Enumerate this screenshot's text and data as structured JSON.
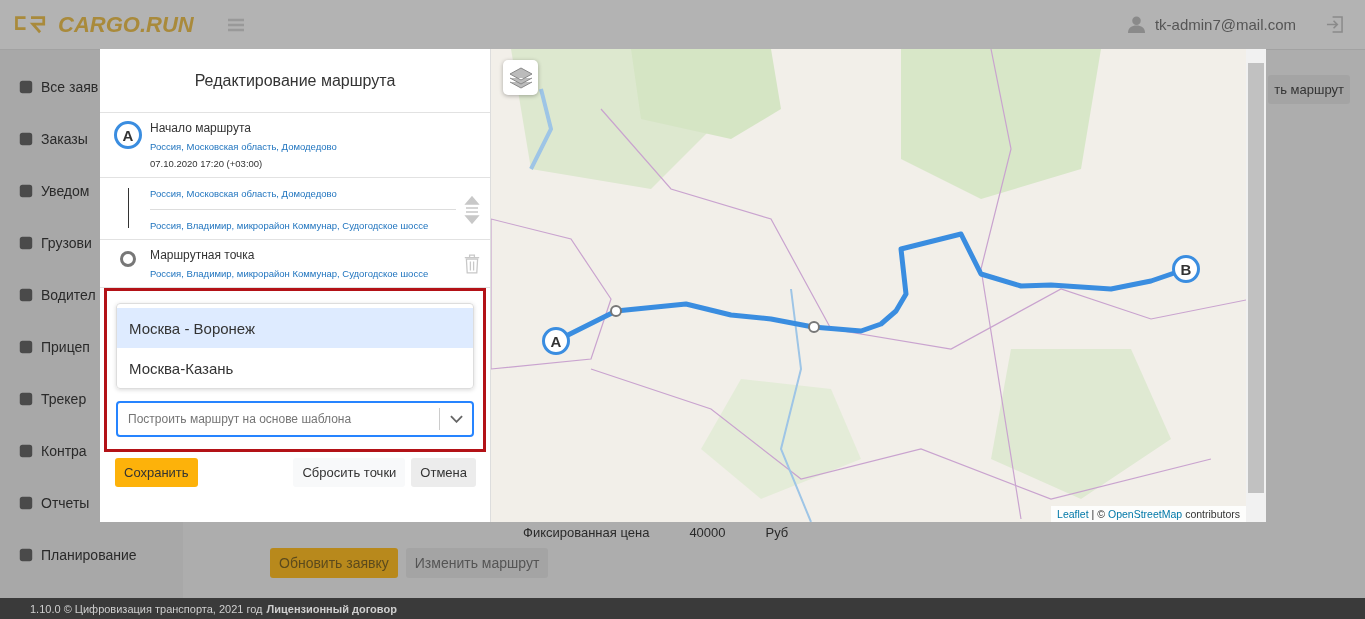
{
  "header": {
    "logo": "CARGO.RUN",
    "user": "tk-admin7@mail.com"
  },
  "sidebar": {
    "items": [
      {
        "label": "Все заяв"
      },
      {
        "label": "Заказы"
      },
      {
        "label": "Уведом"
      },
      {
        "label": "Грузови"
      },
      {
        "label": "Водител"
      },
      {
        "label": "Прицеп"
      },
      {
        "label": "Трекер"
      },
      {
        "label": "Контра"
      },
      {
        "label": "Отчеты"
      },
      {
        "label": "Планирование"
      }
    ]
  },
  "background": {
    "top_button": "ть маршрут",
    "field_label": "Фиксированная цена",
    "field_value": "40000",
    "unit": "Руб",
    "buttons": [
      {
        "label": "Обновить заявку",
        "kind": "primary"
      },
      {
        "label": "Изменить маршрут",
        "kind": "secondary"
      }
    ]
  },
  "modal": {
    "title": "Редактирование маршрута",
    "start": {
      "marker": "A",
      "label": "Начало маршрута",
      "address": "Россия, Московская область, Домодедово",
      "datetime": "07.10.2020 17:20 (+03:00)"
    },
    "segment": {
      "from": "Россия, Московская область, Домодедово",
      "to": "Россия, Владимир, микрорайон Коммунар, Судогодское шоссе"
    },
    "waypoint": {
      "label": "Маршрутная точка",
      "address": "Россия, Владимир, микрорайон Коммунар, Судогодское шоссе"
    },
    "template_select": {
      "placeholder": "Построить маршрут на основе шаблона",
      "options": [
        {
          "label": "Москва - Воронеж",
          "selected": true
        },
        {
          "label": "Москва-Казань",
          "selected": false
        }
      ]
    },
    "buttons": [
      {
        "label": "Сохранить",
        "kind": "primary"
      },
      {
        "label": "Сбросить точки",
        "kind": "link"
      },
      {
        "label": "Отмена",
        "kind": "secondary"
      }
    ]
  },
  "map": {
    "kind": "picture",
    "markers": [
      {
        "label": "A"
      },
      {
        "label": "B"
      }
    ],
    "attribution": {
      "link_1": "Leaflet",
      "separator": "| ©",
      "link_2": "OpenStreetMap",
      "text": "contributors"
    }
  },
  "footer": {
    "text": "1.10.0 © Цифровизация транспорта, 2021 год",
    "link": "Лицензионный договор"
  }
}
